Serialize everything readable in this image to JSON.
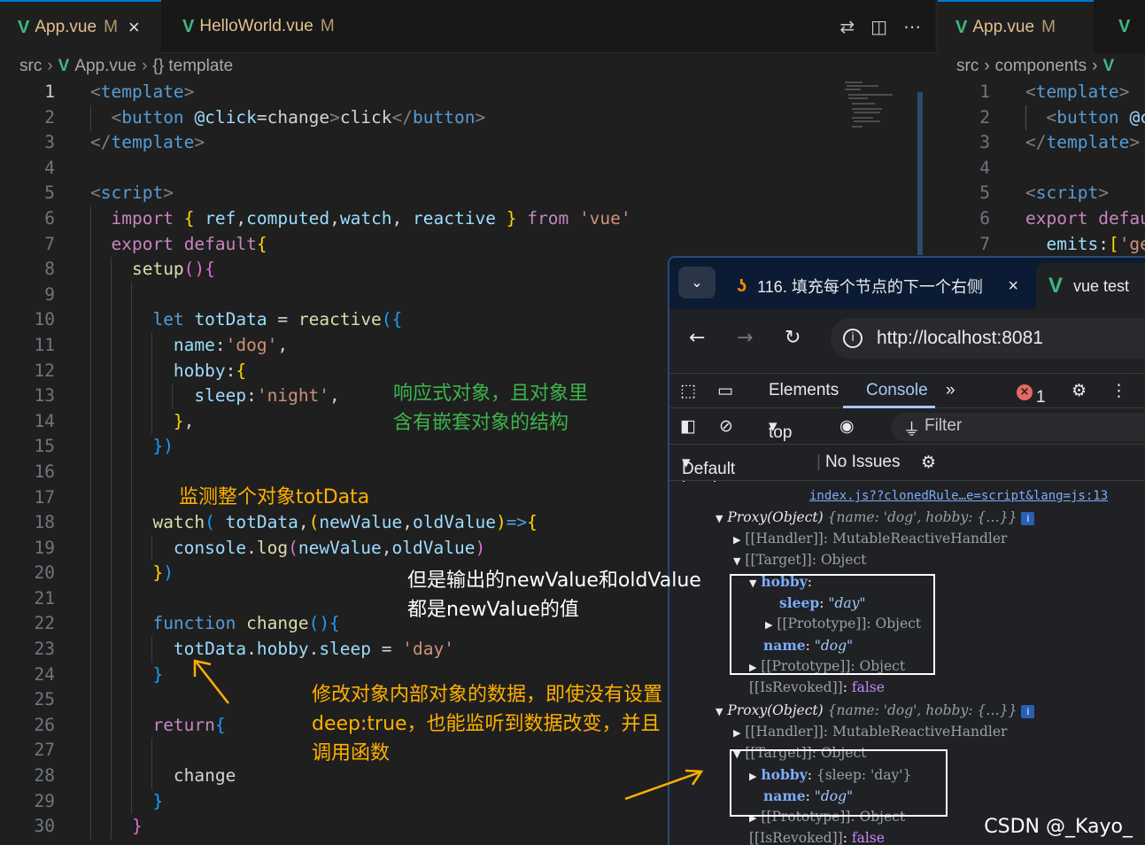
{
  "editor_left": {
    "tabs": [
      {
        "name": "App.vue",
        "badge": "M",
        "close": "×"
      },
      {
        "name": "HelloWorld.vue",
        "badge": "M"
      }
    ],
    "breadcrumb": {
      "folder": "src",
      "file": "App.vue",
      "symbol": "{} template"
    },
    "lines": [
      "1",
      "2",
      "3",
      "4",
      "5",
      "6",
      "7",
      "8",
      "9",
      "10",
      "11",
      "12",
      "13",
      "14",
      "15",
      "16",
      "17",
      "18",
      "19",
      "20",
      "21",
      "22",
      "23",
      "24",
      "25",
      "26",
      "27",
      "28",
      "29",
      "30"
    ]
  },
  "editor_right": {
    "tab": {
      "name": "App.vue",
      "badge": "M"
    },
    "breadcrumb": {
      "folder": "src",
      "sub": "components"
    },
    "lines": [
      "1",
      "2",
      "3",
      "4",
      "5",
      "6",
      "7"
    ]
  },
  "browser": {
    "tabs": [
      {
        "title": "116. 填充每个节点的下一个右侧",
        "close": "×"
      },
      {
        "title": "vue test"
      }
    ],
    "url": "http://localhost:8081",
    "devtools": {
      "tabs": [
        "Elements",
        "Console"
      ],
      "active_tab": "Console",
      "error_count": "1",
      "context": "top",
      "filter_placeholder": "Filter",
      "levels": "Default levels",
      "issues": "No Issues"
    },
    "console": {
      "source_link": "index.js??clonedRule…e=script&lang=js:13",
      "proxy_label": "Proxy(Object)",
      "proxy_preview": "{name: 'dog', hobby: {…}}",
      "handler": "[[Handler]]: MutableReactiveHandler",
      "target": "[[Target]]: Object",
      "hobby_key": "hobby",
      "sleep_key": "sleep",
      "sleep_value_1": "\"day\"",
      "prototype": "[[Prototype]]: Object",
      "name_key": "name",
      "name_value": "\"dog\"",
      "isrevoked": "[[IsRevoked]]",
      "false_value": "false",
      "hobby_preview": "{sleep: 'day'}"
    }
  },
  "annotations": {
    "green": [
      "响应式对象，且对象里",
      "含有嵌套对象的结构"
    ],
    "watch_note": "监测整个对象totData",
    "white": [
      "但是输出的newValue和oldValue",
      "都是newValue的值"
    ],
    "orange": [
      "修改对象内部对象的数据，即使没有设置",
      "deep:true，也能监听到数据改变，并且",
      "调用函数"
    ]
  },
  "watermark": "CSDN @_Kayo_"
}
